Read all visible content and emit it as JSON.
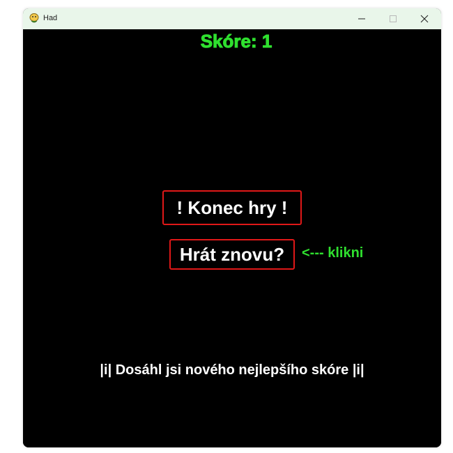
{
  "window": {
    "title": "Had",
    "app_icon": "pygame-snake-icon",
    "controls": {
      "minimize_icon": "minimize-icon",
      "maximize_icon": "maximize-icon",
      "close_icon": "close-icon"
    }
  },
  "game": {
    "score_text": "Skóre: 1",
    "game_over_text": "! Konec hry !",
    "play_again_text": "Hrát znovu?",
    "hint_text": "<--- klikni",
    "record_text": "|i| Dosáhl jsi nového nejlepšího skóre |i|"
  },
  "colors": {
    "background": "#000000",
    "titlebar": "#e9f6ea",
    "accent_green": "#2fe02f",
    "box_border_red": "#e01818",
    "text_white": "#ffffff"
  }
}
